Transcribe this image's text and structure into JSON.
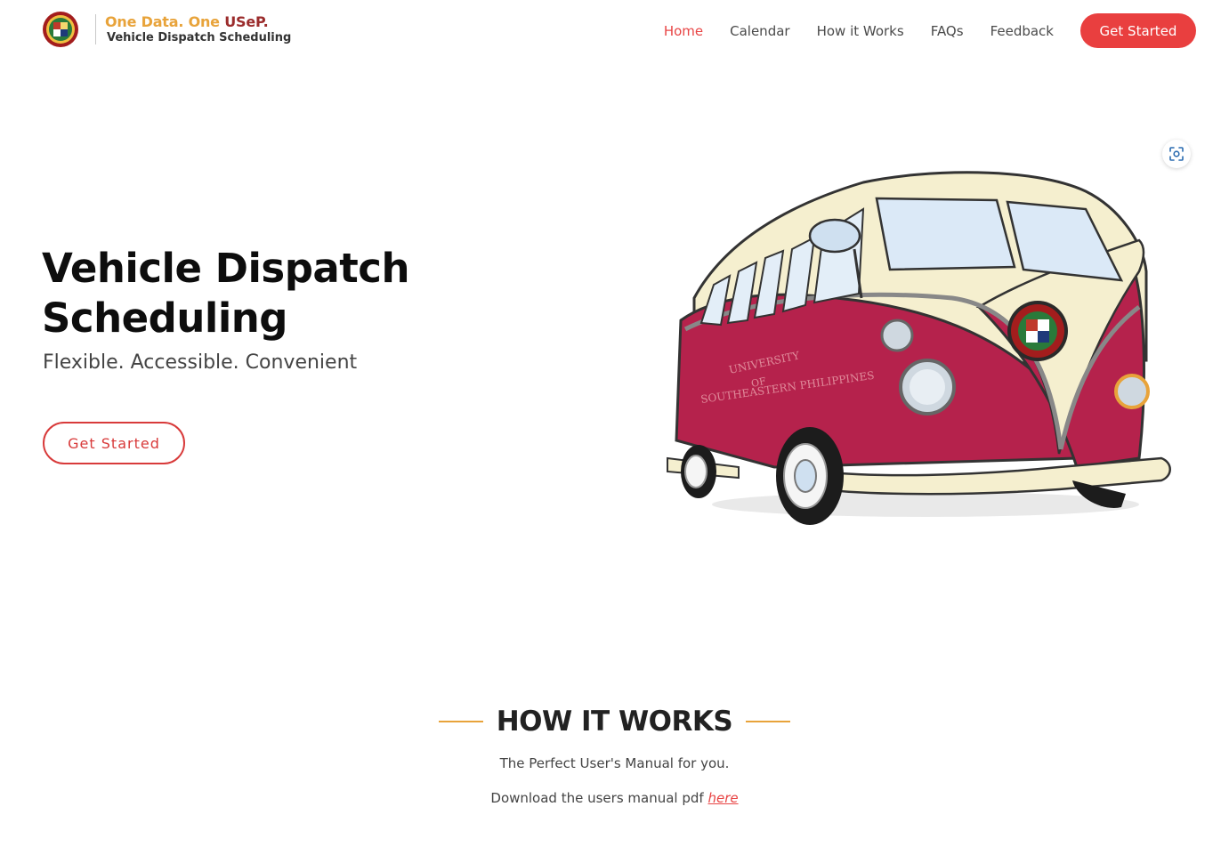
{
  "brand": {
    "tagline_part1": "One Data. ",
    "tagline_part2": "One ",
    "tagline_part3": "USeP.",
    "subtitle": "Vehicle Dispatch Scheduling",
    "logo_icon": "university-seal-icon"
  },
  "nav": {
    "items": [
      {
        "label": "Home",
        "active": true
      },
      {
        "label": "Calendar",
        "active": false
      },
      {
        "label": "How it Works",
        "active": false
      },
      {
        "label": "FAQs",
        "active": false
      },
      {
        "label": "Feedback",
        "active": false
      }
    ],
    "cta_label": "Get Started"
  },
  "hero": {
    "title_line1": "Vehicle Dispatch",
    "title_line2": "Scheduling",
    "subtitle": "Flexible. Accessible. Convenient",
    "cta_label": "Get Started",
    "image_icon": "van-illustration",
    "van_text_line1": "UNIVERSITY",
    "van_text_line2": "OF",
    "van_text_line3": "SOUTHEASTERN PHILIPPINES"
  },
  "how_it_works": {
    "title": "HOW IT WORKS",
    "subtitle": "The Perfect User's Manual for you.",
    "download_text": "Download the users manual pdf ",
    "download_link": "here"
  },
  "colors": {
    "accent_red": "#e93f3f",
    "accent_orange": "#e8a33a",
    "maroon": "#9b2c2c",
    "van_body": "#b5224c",
    "van_top": "#f5efcf"
  }
}
